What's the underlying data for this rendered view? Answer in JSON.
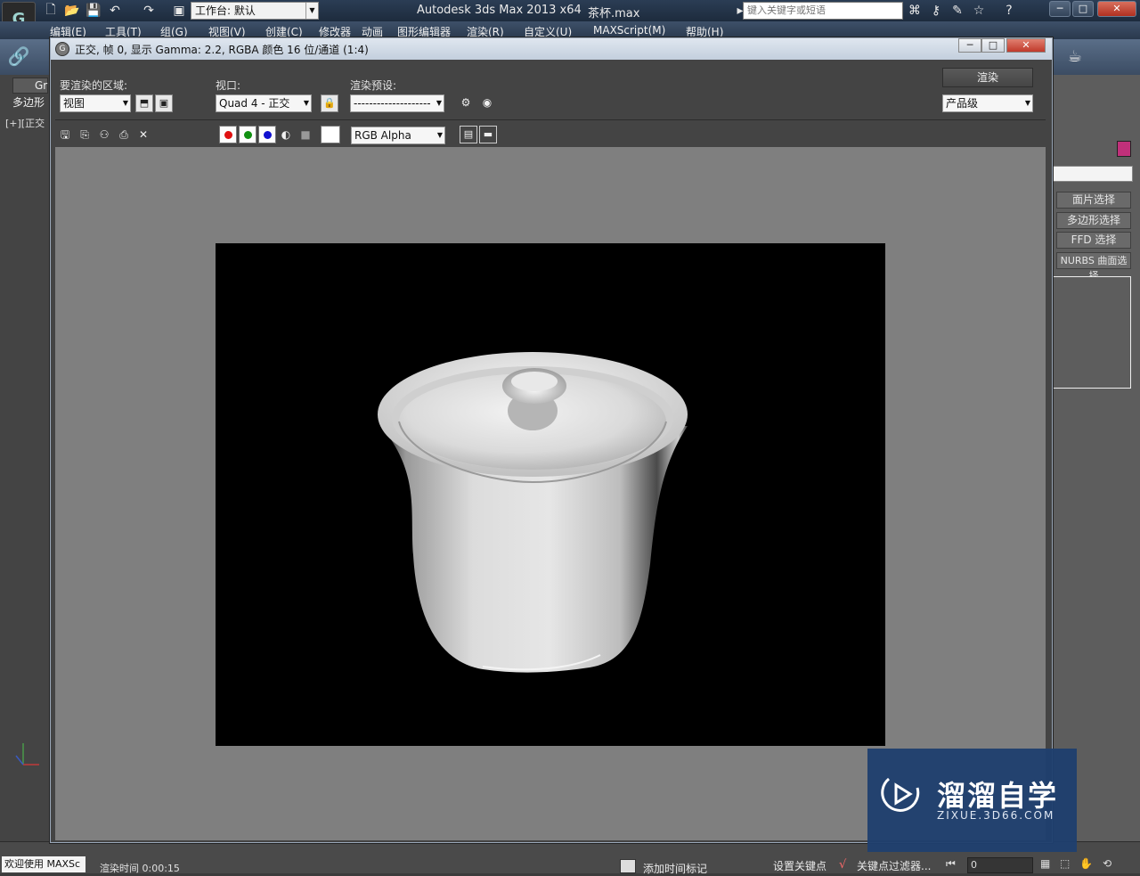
{
  "app": {
    "title": "Autodesk 3ds Max  2013 x64",
    "file": "茶杯.max",
    "logo_text": "G",
    "workspace": "工作台: 默认",
    "search_placeholder": "键入关键字或短语"
  },
  "menu": [
    "编辑(E)",
    "工具(T)",
    "组(G)",
    "视图(V)",
    "创建(C)",
    "修改器",
    "动画",
    "图形编辑器",
    "渲染(R)",
    "自定义(U)",
    "MAXScript(M)",
    "帮助(H)"
  ],
  "background": {
    "ribbon_tab": "Gr",
    "poly_label": "多边形",
    "viewport_label": "[+][正交",
    "right_panel_buttons": [
      "面片选择",
      "多边形选择",
      "FFD 选择",
      "NURBS 曲面选择"
    ]
  },
  "render_frame": {
    "title": "正交, 帧 0, 显示 Gamma: 2.2, RGBA 颜色 16 位/通道 (1:4)",
    "area_label": "要渲染的区域:",
    "area_value": "视图",
    "viewport_label": "视口:",
    "viewport_value": "Quad 4 - 正交",
    "preset_label": "渲染预设:",
    "preset_value": "--------------------",
    "render_button": "渲染",
    "quality_value": "产品级",
    "channel_value": "RGB Alpha",
    "channel_colors": {
      "red": "#e01010",
      "green": "#109010",
      "blue": "#1010d0"
    }
  },
  "status": {
    "welcome": "欢迎使用 MAXSc",
    "render_time": "渲染时间  0:00:15",
    "add_time_tag": "添加时间标记",
    "set_key": "设置关键点",
    "key_filter": "关键点过滤器...",
    "frame_value": "0"
  },
  "watermark": {
    "title": "溜溜自学",
    "url": "ZIXUE.3D66.COM"
  }
}
